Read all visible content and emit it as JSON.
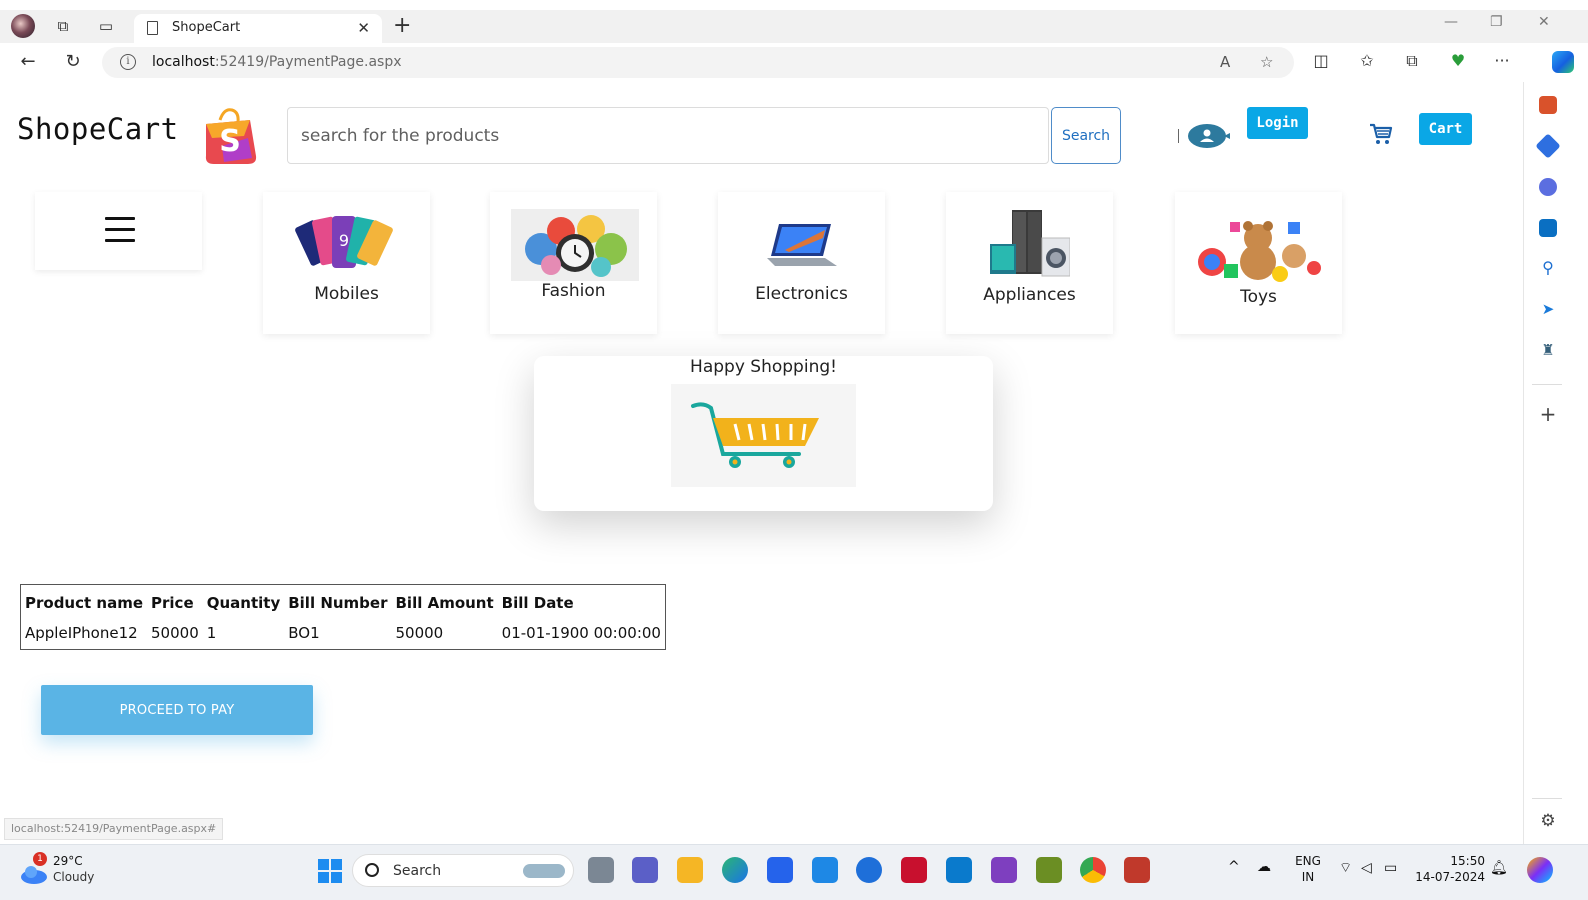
{
  "browser": {
    "tab_title": "ShopeCart",
    "url_host": "localhost",
    "url_rest": ":52419/PaymentPage.aspx",
    "status_link": "localhost:52419/PaymentPage.aspx#"
  },
  "header": {
    "brand": "ShopeCart",
    "search_placeholder": "search for the products",
    "search_button": "Search",
    "login_button": "Login",
    "cart_button": "Cart"
  },
  "categories": [
    {
      "label": "Mobiles"
    },
    {
      "label": "Fashion"
    },
    {
      "label": "Electronics"
    },
    {
      "label": "Appliances"
    },
    {
      "label": "Toys"
    }
  ],
  "modal": {
    "message": "Happy Shopping!"
  },
  "bill": {
    "headers": [
      "Product name",
      "Price",
      "Quantity",
      "Bill Number",
      "Bill Amount",
      "Bill Date"
    ],
    "rows": [
      [
        "AppleIPhone12",
        "50000",
        "1",
        "BO1",
        "50000",
        "01-01-1900 00:00:00"
      ]
    ]
  },
  "actions": {
    "pay_button": "PROCEED TO PAY"
  },
  "taskbar": {
    "weather_temp": "29°C",
    "weather_cond": "Cloudy",
    "weather_badge": "1",
    "search_label": "Search",
    "lang_top": "ENG",
    "lang_bottom": "IN",
    "time": "15:50",
    "date": "14-07-2024"
  },
  "colors": {
    "accent": "#0aa7e6",
    "pay_button": "#5ab4e5",
    "search_border": "#4f8cc9"
  }
}
